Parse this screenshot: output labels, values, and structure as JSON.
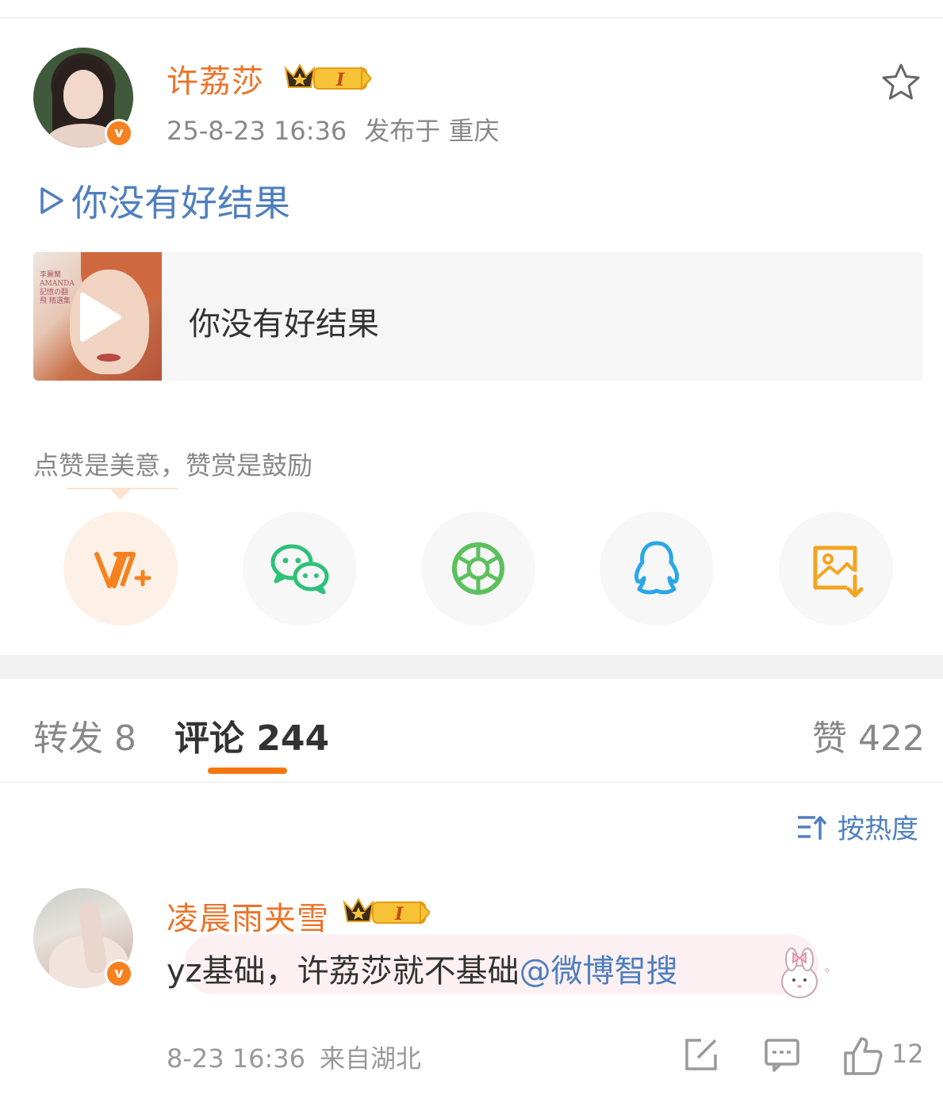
{
  "post": {
    "author": "许荔莎",
    "level_badge": "I",
    "time": "25-8-23 16:36",
    "location": "发布于 重庆",
    "song_link": "你没有好结果",
    "music_card": {
      "title": "你没有好结果",
      "cover_text": "李麗蘭 AMANDA 記憶の翻飛 精選集"
    },
    "reward_tip": "点赞是美意，赞赏是鼓励"
  },
  "share_buttons": [
    {
      "icon": "reward-v-plus-icon",
      "color": "#f5821f"
    },
    {
      "icon": "wechat-icon",
      "color": "#2ec17a"
    },
    {
      "icon": "moments-icon",
      "color": "#5cc05c"
    },
    {
      "icon": "qq-icon",
      "color": "#2aa7e8"
    },
    {
      "icon": "save-image-icon",
      "color": "#f3a420"
    }
  ],
  "tabs": {
    "repost": "转发 8",
    "comments": "评论 244",
    "likes": "赞 422"
  },
  "sort": {
    "label": "按热度"
  },
  "comment": {
    "author": "凌晨雨夹雪",
    "level_badge": "I",
    "text": "yz基础，许荔莎就不基础",
    "mention": "@微博智搜",
    "time": "8-23 16:36",
    "location": "来自湖北",
    "like_count": "12"
  },
  "colors": {
    "accent": "#f5760f",
    "username": "#eb7328",
    "link": "#4f7fbf"
  }
}
